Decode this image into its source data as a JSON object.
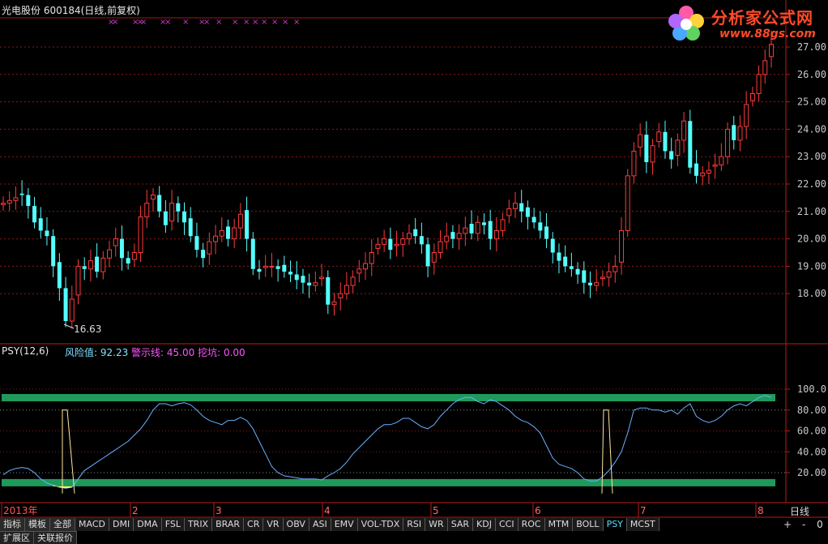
{
  "header": {
    "stock_title": "光电股份 600184(日线,前复权)"
  },
  "logo": {
    "title": "分析家公式网",
    "url_text": "www.88gs.com"
  },
  "price_panel": {
    "y_ticks": [
      "27.00",
      "26.00",
      "25.00",
      "24.00",
      "23.00",
      "22.00",
      "21.00",
      "20.00",
      "19.00",
      "18.00"
    ],
    "low_annotation": "16.63"
  },
  "psy_panel": {
    "title": "PSY(12,6)",
    "risk_label": "风险值: 92.23",
    "warn_label": "警示线: 45.00",
    "dig_label": "挖坑: 0.00",
    "y_ticks": [
      "100.0",
      "80.00",
      "60.00",
      "40.00",
      "20.00"
    ]
  },
  "x_axis": {
    "labels": [
      "2013年",
      "2",
      "3",
      "4",
      "5",
      "6",
      "7",
      "8"
    ],
    "period": "日线"
  },
  "tabs": [
    "指标",
    "模板",
    "全部",
    "MACD",
    "DMI",
    "DMA",
    "FSL",
    "TRIX",
    "BRAR",
    "CR",
    "VR",
    "OBV",
    "ASI",
    "EMV",
    "VOL-TDX",
    "RSI",
    "WR",
    "SAR",
    "KDJ",
    "CCI",
    "ROC",
    "MTM",
    "BOLL",
    "PSY",
    "MCST"
  ],
  "active_tab": "PSY",
  "bottom_tabs": [
    "扩展区",
    "关联报价"
  ],
  "nav": [
    "+",
    "-",
    "0"
  ],
  "colors": {
    "up": "#ff3b3b",
    "down": "#54ffff",
    "psy_line": "#6ab0ff",
    "band": "#1f9a5a",
    "alert_fill": "#ff2a9a",
    "low_fill": "#ffff55",
    "signal": "#ffe8a0"
  },
  "chart_data": [
    {
      "type": "candlestick",
      "title": "光电股份 600184(日线,前复权)",
      "ylim": [
        16.5,
        27.3
      ],
      "annotations": [
        {
          "text": "16.63",
          "value": 16.63
        }
      ],
      "close_series": [
        21.3,
        21.4,
        21.5,
        21.6,
        21.2,
        20.6,
        20.3,
        20.1,
        19.0,
        18.2,
        17.0,
        17.8,
        19.0,
        18.9,
        19.2,
        18.8,
        19.3,
        19.6,
        20.0,
        19.3,
        19.1,
        19.5,
        20.8,
        21.3,
        21.6,
        21.0,
        20.5,
        21.3,
        21.0,
        20.6,
        20.1,
        19.6,
        19.3,
        19.9,
        20.1,
        20.3,
        20.0,
        20.4,
        20.9,
        20.0,
        18.9,
        18.8,
        19.0,
        19.0,
        18.9,
        18.8,
        18.7,
        18.5,
        18.4,
        18.3,
        18.4,
        18.6,
        17.6,
        17.7,
        18.0,
        18.3,
        18.6,
        18.9,
        19.1,
        19.5,
        19.8,
        20.0,
        19.6,
        19.8,
        20.0,
        20.2,
        20.1,
        19.8,
        19.0,
        19.5,
        19.9,
        20.1,
        20.0,
        20.2,
        20.4,
        20.2,
        20.6,
        20.5,
        20.0,
        20.3,
        20.7,
        21.1,
        21.3,
        21.0,
        20.8,
        20.6,
        20.3,
        20.0,
        19.5,
        19.2,
        19.0,
        18.9,
        18.7,
        18.4,
        18.3,
        18.4,
        18.6,
        18.8,
        19.0,
        20.3,
        22.3,
        23.2,
        23.8,
        22.8,
        23.4,
        23.9,
        23.2,
        22.9,
        23.6,
        24.3,
        22.6,
        22.3,
        22.4,
        22.5,
        22.7,
        23.0,
        24.0,
        23.6,
        24.1,
        24.9,
        25.3,
        26.0,
        26.5,
        27.1
      ]
    },
    {
      "type": "line",
      "title": "PSY(12,6)",
      "ylim": [
        0,
        103
      ],
      "reference_lines": [
        {
          "value": 92.23
        },
        {
          "value": 10
        }
      ],
      "series": [
        {
          "values": [
            18,
            22,
            24,
            25,
            24,
            20,
            14,
            10,
            8,
            6,
            5,
            6,
            14,
            22,
            26,
            30,
            34,
            38,
            42,
            46,
            50,
            56,
            62,
            70,
            80,
            86,
            86,
            84,
            86,
            87,
            85,
            80,
            74,
            70,
            68,
            66,
            70,
            70,
            73,
            70,
            62,
            50,
            38,
            26,
            20,
            17,
            16,
            15,
            14,
            14,
            14,
            13,
            17,
            20,
            24,
            30,
            38,
            44,
            50,
            56,
            62,
            66,
            66,
            68,
            72,
            72,
            68,
            64,
            62,
            66,
            74,
            80,
            86,
            90,
            92,
            92,
            88,
            86,
            90,
            88,
            84,
            80,
            74,
            70,
            68,
            64,
            58,
            46,
            34,
            28,
            26,
            24,
            20,
            14,
            12,
            12,
            16,
            22,
            30,
            40,
            58,
            80,
            82,
            82,
            80,
            80,
            78,
            80,
            76,
            82,
            86,
            74,
            70,
            68,
            70,
            74,
            80,
            84,
            86,
            84,
            88,
            92,
            94,
            92
          ]
        }
      ]
    }
  ]
}
